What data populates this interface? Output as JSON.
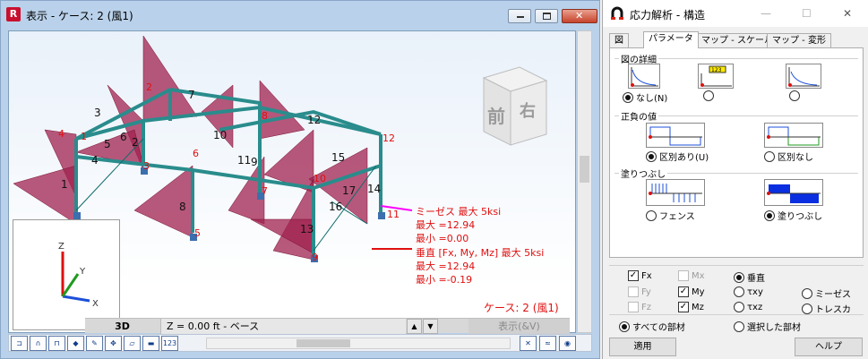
{
  "view": {
    "title": "表示 - ケース: 2 (風1)",
    "logo": "R",
    "mode": "3D",
    "zlevel": "Z = 0.00 ft - ベース",
    "show_button": "表示(&V)",
    "case_label": "ケース: 2 (風1)",
    "cube_front": "前",
    "cube_right": "右",
    "axis_labels": {
      "z": "Z",
      "y": "Y",
      "x": "X"
    },
    "info_mises": [
      "ミーゼス 最大 5ksi",
      "最大 =12.94",
      "最小 =0.00"
    ],
    "info_normal": [
      "垂直 [Fx, My, Mz] 最大 5ksi",
      "最大 =12.94",
      "最小 =-0.19"
    ],
    "node_labels_red": [
      "1",
      "2",
      "3",
      "4",
      "5",
      "6",
      "7",
      "8",
      "9",
      "10",
      "11",
      "12"
    ],
    "member_labels": [
      "1",
      "2",
      "3",
      "4",
      "5",
      "6",
      "7",
      "8",
      "9",
      "10",
      "11",
      "12",
      "13",
      "14",
      "15",
      "16",
      "17"
    ],
    "toolbar_items": [
      "dim-line-1",
      "dim-line-2",
      "dim-line-3",
      "shape",
      "brush",
      "move",
      "plane",
      "flat",
      "label-123"
    ],
    "toolbar_right": [
      "cross-hatch",
      "view-lines",
      "eye"
    ]
  },
  "panel": {
    "title": "応力解析 - 構造",
    "controls": {
      "min": "—",
      "max": "☐",
      "close": "✕"
    },
    "tabs": [
      "図",
      "パラメータ",
      "マップ - スケール",
      "マップ - 変形"
    ],
    "active_tab": 1,
    "group_detail": {
      "title": "図の詳細",
      "options": [
        {
          "label": "なし(N)",
          "selected": true
        },
        {
          "label": "",
          "selected": false
        },
        {
          "label": "",
          "selected": false
        }
      ]
    },
    "group_sign": {
      "title": "正負の値",
      "options": [
        {
          "label": "区別あり(U)",
          "selected": true
        },
        {
          "label": "区別なし",
          "selected": false
        }
      ]
    },
    "group_fill": {
      "title": "塗りつぶし",
      "options": [
        {
          "label": "フェンス",
          "selected": false
        },
        {
          "label": "塗りつぶし",
          "selected": true
        }
      ]
    },
    "checks": [
      {
        "label": "Fx",
        "checked": true,
        "enabled": true
      },
      {
        "label": "Mx",
        "checked": false,
        "enabled": false
      },
      {
        "label": "Fy",
        "checked": false,
        "enabled": false
      },
      {
        "label": "My",
        "checked": true,
        "enabled": true
      },
      {
        "label": "Fz",
        "checked": false,
        "enabled": false
      },
      {
        "label": "Mz",
        "checked": true,
        "enabled": true
      }
    ],
    "stress_types": [
      {
        "label": "垂直",
        "selected": true
      },
      {
        "label": "τxy",
        "selected": false
      },
      {
        "label": "ミーゼス",
        "selected": false
      },
      {
        "label": "τxz",
        "selected": false
      },
      {
        "label": "トレスカ",
        "selected": false
      }
    ],
    "scope": [
      {
        "label": "すべての部材",
        "selected": true
      },
      {
        "label": "選択した部材",
        "selected": false
      }
    ],
    "apply_button": "適用",
    "help_button": "ヘルプ",
    "picture_labels": {
      "b123": "123"
    }
  }
}
